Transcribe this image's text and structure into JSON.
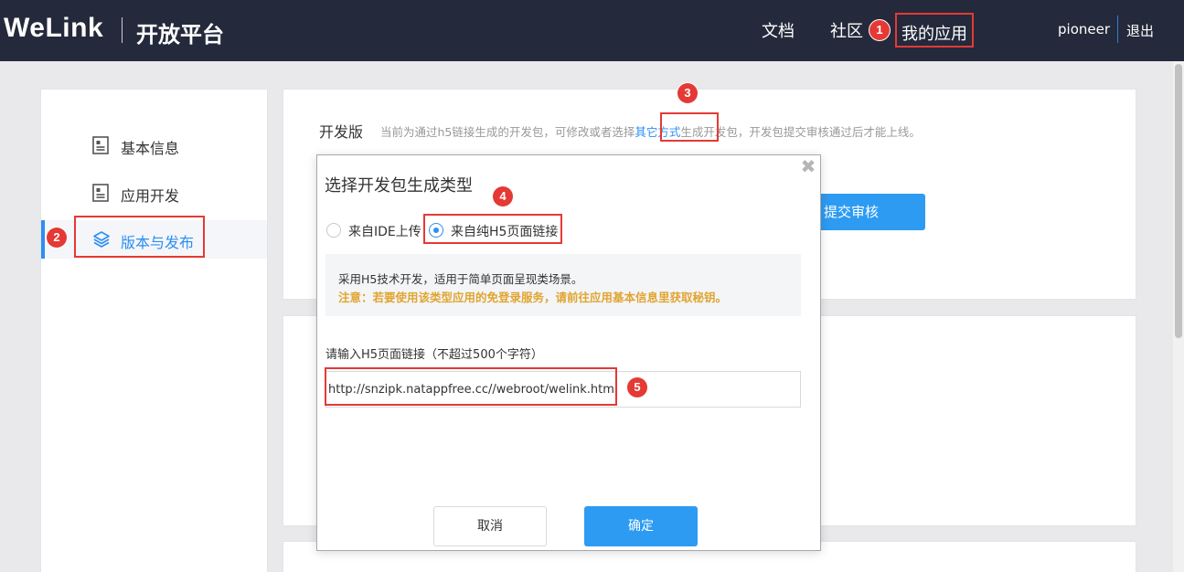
{
  "header": {
    "logo": "WeLink",
    "platform": "开放平台",
    "nav": {
      "docs": "文档",
      "community": "社区",
      "my_apps": "我的应用"
    },
    "user": "pioneer",
    "logout": "退出"
  },
  "sidebar": {
    "items": [
      {
        "label": "基本信息",
        "icon": "document-icon"
      },
      {
        "label": "应用开发",
        "icon": "document-icon"
      },
      {
        "label": "版本与发布",
        "icon": "layers-icon",
        "active": true
      }
    ]
  },
  "dev_panel": {
    "title": "开发版",
    "desc_before": "当前为通过h5链接生成的开发包，可修改或者选择",
    "desc_link": "其它方式",
    "desc_after": "生成开发包，开发包提交审核通过后才能上线。",
    "submit_label": "提交审核"
  },
  "modal": {
    "title": "选择开发包生成类型",
    "options": [
      {
        "label": "来自IDE上传",
        "selected": false
      },
      {
        "label": "来自纯H5页面链接",
        "selected": true
      }
    ],
    "info_line1": "采用H5技术开发，适用于简单页面呈现类场景。",
    "info_line2": "注意：若要使用该类型应用的免登录服务，请前往应用基本信息里获取秘钥。",
    "url_label": "请输入H5页面链接（不超过500个字符）",
    "url_value": "http://snzipk.natappfree.cc//webroot/welink.html",
    "cancel_label": "取消",
    "ok_label": "确定"
  },
  "annotations": [
    "1",
    "2",
    "3",
    "4",
    "5"
  ],
  "colors": {
    "header_bg": "#242a3b",
    "accent": "#2d8ef3",
    "marker": "#e53935",
    "warning": "#e0a531"
  }
}
